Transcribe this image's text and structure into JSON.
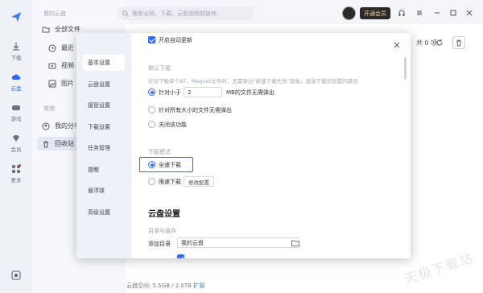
{
  "nav": {
    "header": "我的云盘",
    "all_files": "全部文件",
    "recent": "最近",
    "video": "视频",
    "pictures": "图片",
    "section_common": "常用",
    "my_share": "我的分享",
    "recycle_bin": "回收站"
  },
  "rail": {
    "download": "下载",
    "cloud": "云盘",
    "games": "游戏",
    "vip": "会员",
    "more": "更多"
  },
  "search": {
    "placeholder": "搜索全网、下载、云盘视频超链地"
  },
  "topbar": {
    "vip_button": "开通会员"
  },
  "main": {
    "count": "共 0 项",
    "storage": "云盘空间: 5.5GB / 2.0TB",
    "expand": "扩容",
    "watermark": "天极下载站"
  },
  "dialog": {
    "tabs": [
      "基本设置",
      "云盘设置",
      "接管设置",
      "下载设置",
      "任务管理",
      "提醒",
      "悬浮球",
      "高级设置"
    ],
    "auto_update": "开启自动更新",
    "default_download": "默认下载",
    "default_hint": "针对下载单个BT、Magnet文件时，无需弹出“新建下载任务”面板，直接下载到设置的路径",
    "opt_lt": "针对小于",
    "size_value": "2",
    "opt_lt_suffix": "MB的文件无需弹出",
    "opt_all": "针对所有大小的文件无需弹出",
    "opt_off": "关闭该功能",
    "download_mode": "下载模式",
    "full_speed": "全速下载",
    "limited_speed": "限速下载",
    "modify_config": "修改配置",
    "cloud_settings": "云盘设置",
    "dir_cache": "目录与缓存",
    "add_dir": "添加目录",
    "dir_value": "我的云盘"
  }
}
